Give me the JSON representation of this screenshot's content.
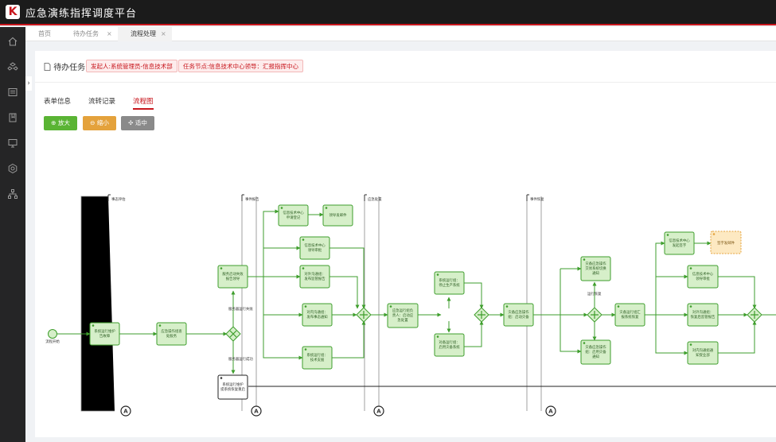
{
  "app": {
    "logo_letter": "K",
    "title": "应急演练指挥调度平台"
  },
  "sidebar": {
    "icons": [
      "home-icon",
      "cubes-icon",
      "list-icon",
      "book-icon",
      "monitor-icon",
      "settings-icon",
      "org-icon"
    ]
  },
  "tabs": [
    {
      "label": "首页"
    },
    {
      "label": "待办任务",
      "close": "×"
    },
    {
      "label": "流程处理",
      "close": "×"
    }
  ],
  "panel": {
    "title": "待办任务",
    "tags": [
      "发起人:系统管理员-信息技术部",
      "任务节点:信息技术中心领导：汇报指挥中心"
    ],
    "subtabs": [
      "表单信息",
      "流转记录",
      "流程图"
    ],
    "buttons": [
      {
        "label": "放大",
        "icon": "plus",
        "color": "#5ab434"
      },
      {
        "label": "缩小",
        "icon": "minus",
        "color": "#e4a23c"
      },
      {
        "label": "适中",
        "icon": "move",
        "color": "#8a8a8a"
      }
    ]
  },
  "flow": {
    "swimlanes": [
      "事态评估",
      "事件报告",
      "应急处置",
      "事件恢复"
    ],
    "start_label": "流程开始",
    "collapse_arrow": "›",
    "end_marker": "A",
    "edge_labels": [
      "服务器运行失败",
      "服务器运行成功",
      "运行恢复"
    ],
    "nodes": {
      "n1": [
        "系统运行维护",
        "告故障"
      ],
      "n2": [
        "应急操作组查",
        "处服务"
      ],
      "n3": [
        "服务启动失败",
        "报告领导"
      ],
      "n4": [
        "系统运行维护",
        "提系统恢复重启"
      ],
      "n5": [
        "信息技术中心",
        "申请登记"
      ],
      "n6": [
        "领导发邮件"
      ],
      "n7": [
        "信息技术中心",
        "领导审批"
      ],
      "n8": [
        "对外沟通组：",
        "发布监管报告"
      ],
      "n9": [
        "对内沟通组：",
        "发布事态通知"
      ],
      "n10": [
        "系统运行组：",
        "技术支援"
      ],
      "n11": [
        "应急运行组负",
        "责人：启动应",
        "急处置"
      ],
      "n12": [
        "系统运行组：",
        "停止生产系统"
      ],
      "n13": [
        "对备运行组：",
        "启用灾备系统"
      ],
      "n14": [
        "灾备应急操作",
        "组：启动灾备"
      ],
      "n15": [
        "灾备应急操作",
        "交易系统切换",
        "通知"
      ],
      "n16": [
        "灾备运行组汇",
        "报系统恢复"
      ],
      "n17": [
        "灾备应急操作",
        "组：启用灾备",
        "通知"
      ],
      "n18": [
        "信息技术中心",
        "发起签字"
      ],
      "n19": [
        "签字发邮件"
      ],
      "n20": [
        "信息技术中心",
        "领导审批"
      ],
      "n21": [
        "对外沟通组：",
        "恢复后监管报告"
      ],
      "n22": [
        "对内沟通组通",
        "知受业部"
      ]
    }
  }
}
